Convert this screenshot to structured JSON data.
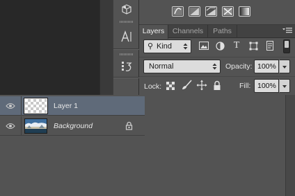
{
  "layers_panel": {
    "tabs": [
      {
        "label": "Layers",
        "active": true
      },
      {
        "label": "Channels",
        "active": false
      },
      {
        "label": "Paths",
        "active": false
      }
    ],
    "filter": {
      "kind_label": "Kind",
      "filter_icons": [
        "image-filter-icon",
        "adjustment-filter-icon",
        "type-filter-icon",
        "shape-filter-icon",
        "smart-object-filter-icon"
      ]
    },
    "blend_mode": "Normal",
    "opacity": {
      "label": "Opacity:",
      "value": "100%"
    },
    "lock": {
      "label": "Lock:",
      "icons": [
        "lock-transparent-pixels-icon",
        "lock-image-pixels-icon",
        "lock-position-icon",
        "lock-all-icon"
      ]
    },
    "fill": {
      "label": "Fill:",
      "value": "100%"
    },
    "layers": [
      {
        "name": "Layer 1",
        "visible": true,
        "selected": true,
        "locked": false,
        "italic": false,
        "thumbnail": "transparent-checker"
      },
      {
        "name": "Background",
        "visible": true,
        "selected": false,
        "locked": true,
        "italic": true,
        "thumbnail": "landscape-photo"
      }
    ]
  },
  "adjustments_row": {
    "icons": [
      "gradient-map-icon",
      "curves-icon",
      "levels-icon",
      "channel-mixer-icon",
      "gradient-icon"
    ]
  },
  "tool_strip": {
    "icons": [
      "3d-cube-icon",
      "character-icon",
      "history-icon"
    ]
  },
  "colors": {
    "panel_bg": "#535353",
    "selected_layer": "#5f6a79",
    "canvas_bg": "#282828"
  }
}
